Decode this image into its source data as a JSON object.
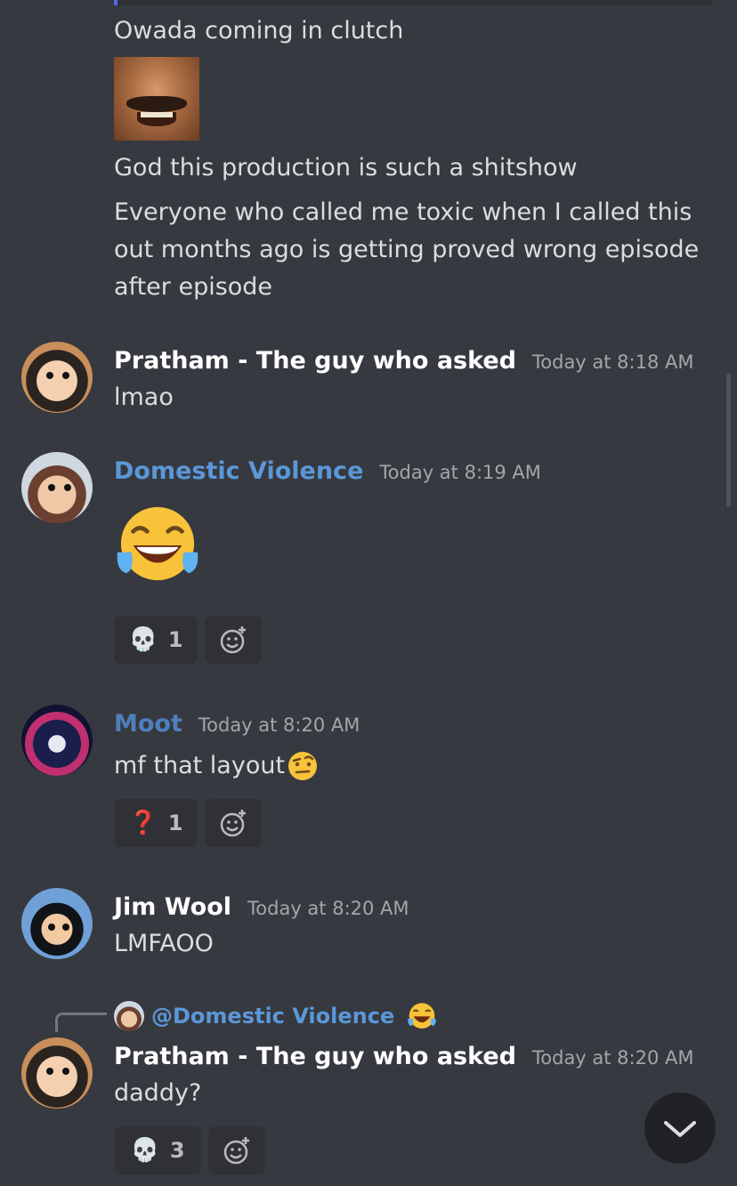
{
  "messages": {
    "continued": {
      "line1": "Owada coming in clutch",
      "line2": "God this production is such a shitshow",
      "line3": "Everyone who called me toxic when I called this out months ago is getting proved wrong episode after episode"
    },
    "m1": {
      "username": "Pratham - The guy who asked",
      "timestamp": "Today at 8:18 AM",
      "text": "lmao"
    },
    "m2": {
      "username": "Domestic Violence",
      "timestamp": "Today at 8:19 AM",
      "emoji": "joy-emoji",
      "reactions": [
        {
          "emoji": "💀",
          "count": "1"
        }
      ]
    },
    "m3": {
      "username": "Moot",
      "timestamp": "Today at 8:20 AM",
      "text": "mf that layout",
      "reactions": [
        {
          "emoji": "❓",
          "count": "1"
        }
      ]
    },
    "m4": {
      "username": "Jim Wool",
      "timestamp": "Today at 8:20 AM",
      "text": "LMFAOO"
    },
    "m5": {
      "reply_to": "@Domestic Violence",
      "username": "Pratham - The guy who asked",
      "timestamp": "Today at 8:20 AM",
      "text": "daddy?",
      "reactions": [
        {
          "emoji": "💀",
          "count": "3"
        }
      ]
    }
  },
  "colors": {
    "background": "#36393f",
    "reaction_bg": "#2f3136",
    "username_white": "#ffffff",
    "username_blue": "#5b97d9",
    "timestamp": "#a3a6aa"
  },
  "icons": {
    "add_reaction": "add-reaction-icon",
    "jump_down": "chevron-down-icon"
  }
}
